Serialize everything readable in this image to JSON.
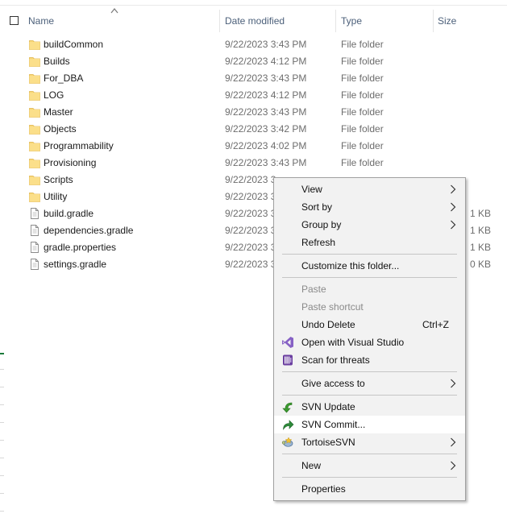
{
  "columns": {
    "name": "Name",
    "date_modified": "Date modified",
    "type": "Type",
    "size": "Size"
  },
  "files": [
    {
      "name": "buildCommon",
      "date": "9/22/2023 3:43 PM",
      "type": "File folder",
      "size": "",
      "icon": "folder-icon"
    },
    {
      "name": "Builds",
      "date": "9/22/2023 4:12 PM",
      "type": "File folder",
      "size": "",
      "icon": "folder-icon"
    },
    {
      "name": "For_DBA",
      "date": "9/22/2023 3:43 PM",
      "type": "File folder",
      "size": "",
      "icon": "folder-icon"
    },
    {
      "name": "LOG",
      "date": "9/22/2023 4:12 PM",
      "type": "File folder",
      "size": "",
      "icon": "folder-icon"
    },
    {
      "name": "Master",
      "date": "9/22/2023 3:43 PM",
      "type": "File folder",
      "size": "",
      "icon": "folder-icon"
    },
    {
      "name": "Objects",
      "date": "9/22/2023 3:42 PM",
      "type": "File folder",
      "size": "",
      "icon": "folder-icon"
    },
    {
      "name": "Programmability",
      "date": "9/22/2023 4:02 PM",
      "type": "File folder",
      "size": "",
      "icon": "folder-icon"
    },
    {
      "name": "Provisioning",
      "date": "9/22/2023 3:43 PM",
      "type": "File folder",
      "size": "",
      "icon": "folder-icon"
    },
    {
      "name": "Scripts",
      "date": "9/22/2023 3",
      "type": "",
      "size": "",
      "icon": "folder-icon"
    },
    {
      "name": "Utility",
      "date": "9/22/2023 3",
      "type": "",
      "size": "",
      "icon": "folder-icon"
    },
    {
      "name": "build.gradle",
      "date": "9/22/2023 3",
      "type": "",
      "size": "1 KB",
      "icon": "file-icon"
    },
    {
      "name": "dependencies.gradle",
      "date": "9/22/2023 3",
      "type": "",
      "size": "1 KB",
      "icon": "file-icon"
    },
    {
      "name": "gradle.properties",
      "date": "9/22/2023 3",
      "type": "",
      "size": "1 KB",
      "icon": "file-icon"
    },
    {
      "name": "settings.gradle",
      "date": "9/22/2023 3",
      "type": "",
      "size": "0 KB",
      "icon": "file-icon"
    }
  ],
  "context_menu": {
    "items": [
      {
        "label": "View",
        "submenu": true
      },
      {
        "label": "Sort by",
        "submenu": true
      },
      {
        "label": "Group by",
        "submenu": true
      },
      {
        "label": "Refresh"
      },
      {
        "label": "Customize this folder..."
      },
      {
        "label": "Paste",
        "disabled": true
      },
      {
        "label": "Paste shortcut",
        "disabled": true
      },
      {
        "label": "Undo Delete",
        "shortcut": "Ctrl+Z"
      },
      {
        "label": "Open with Visual Studio",
        "icon": "visual-studio-icon"
      },
      {
        "label": "Scan for threats",
        "icon": "defender-scan-icon"
      },
      {
        "label": "Give access to",
        "submenu": true
      },
      {
        "label": "SVN Update",
        "icon": "svn-update-icon"
      },
      {
        "label": "SVN Commit...",
        "icon": "svn-commit-icon",
        "highlighted": true
      },
      {
        "label": "TortoiseSVN",
        "icon": "tortoisesvn-icon",
        "submenu": true
      },
      {
        "label": "New",
        "submenu": true
      },
      {
        "label": "Properties"
      }
    ]
  },
  "colors": {
    "folder": "#f8d775",
    "header_text": "#4c607a",
    "menu_bg": "#f2f2f2",
    "menu_hover": "#ffffff",
    "visual_studio": "#8661c5",
    "svn_update": "#3a9a2e",
    "svn_commit": "#2e8a3a"
  }
}
